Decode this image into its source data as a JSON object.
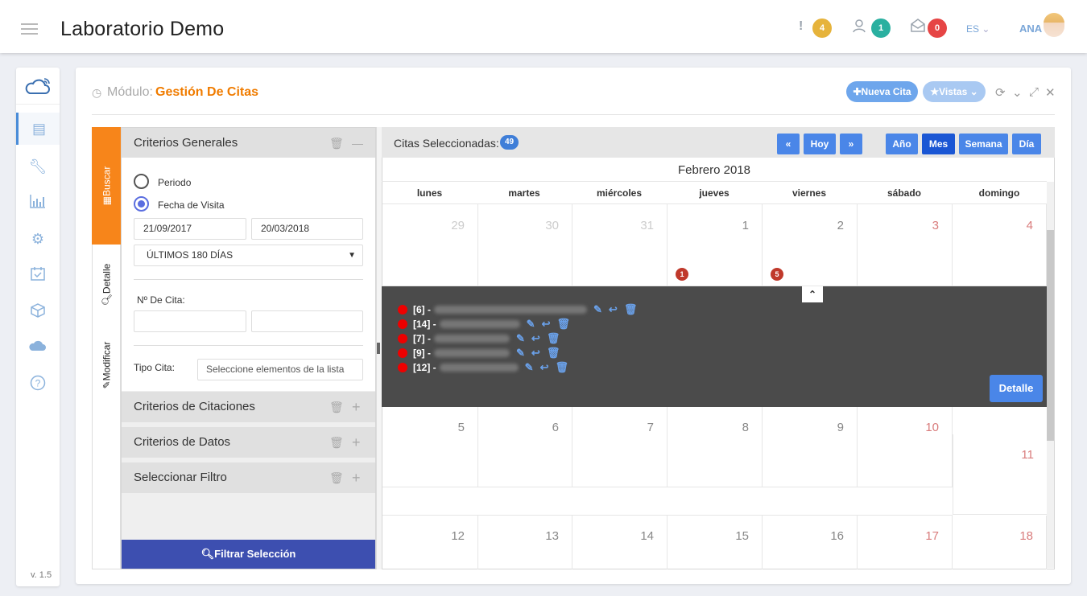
{
  "app": {
    "title": "Laboratorio Demo",
    "version": "v. 1.5"
  },
  "topbar": {
    "alerts_count": "4",
    "alerts_color": "#e6b33b",
    "users_count": "1",
    "users_color": "#2ab0a0",
    "messages_count": "0",
    "messages_color": "#e64545",
    "lang": "ES",
    "user": "ANA"
  },
  "sidebar": {
    "items": [
      "news-icon",
      "wrench-icon",
      "bar-chart-icon",
      "gear-icon",
      "calendar-check-icon",
      "cube-icon",
      "cloud-icon",
      "help-icon"
    ]
  },
  "module": {
    "label": "Módulo:",
    "name": "Gestión De Citas",
    "new_btn": "Nueva Cita",
    "views_btn": "Vistas"
  },
  "tabs": {
    "buscar": "Buscar",
    "detalle": "Detalle",
    "modificar": "Modificar"
  },
  "criteria": {
    "general": "Criterios Generales",
    "periodo": "Periodo",
    "fecha_visita": "Fecha de Visita",
    "date_from": "21/09/2017",
    "date_to": "20/03/2018",
    "range": "ÚLTIMOS 180 DÍAS",
    "num_cita": "Nº De Cita:",
    "tipo_cita": "Tipo Cita:",
    "tipo_placeholder": "Seleccione elementos de la lista",
    "citaciones": "Criterios de Citaciones",
    "datos": "Criterios de Datos",
    "filtro": "Seleccionar Filtro",
    "filtrar_btn": "Filtrar Selección"
  },
  "calendar": {
    "selected_label": "Citas Seleccionadas:",
    "selected_count": "49",
    "today": "Hoy",
    "views": [
      "Año",
      "Mes",
      "Semana",
      "Día"
    ],
    "month": "Febrero 2018",
    "weekdays": [
      "lunes",
      "martes",
      "miércoles",
      "jueves",
      "viernes",
      "sábado",
      "domingo"
    ],
    "week1": [
      "29",
      "30",
      "31",
      "1",
      "2",
      "3",
      "4"
    ],
    "week2": [
      "5",
      "6",
      "7",
      "8",
      "9",
      "10",
      "11"
    ],
    "week3": [
      "12",
      "13",
      "14",
      "15",
      "16",
      "17",
      "18"
    ],
    "badge_thu": "1",
    "badge_fri": "5",
    "events": [
      "[6] -",
      "[14] -",
      "[7] -",
      "[9] -",
      "[12] -"
    ],
    "detail_btn": "Detalle"
  }
}
